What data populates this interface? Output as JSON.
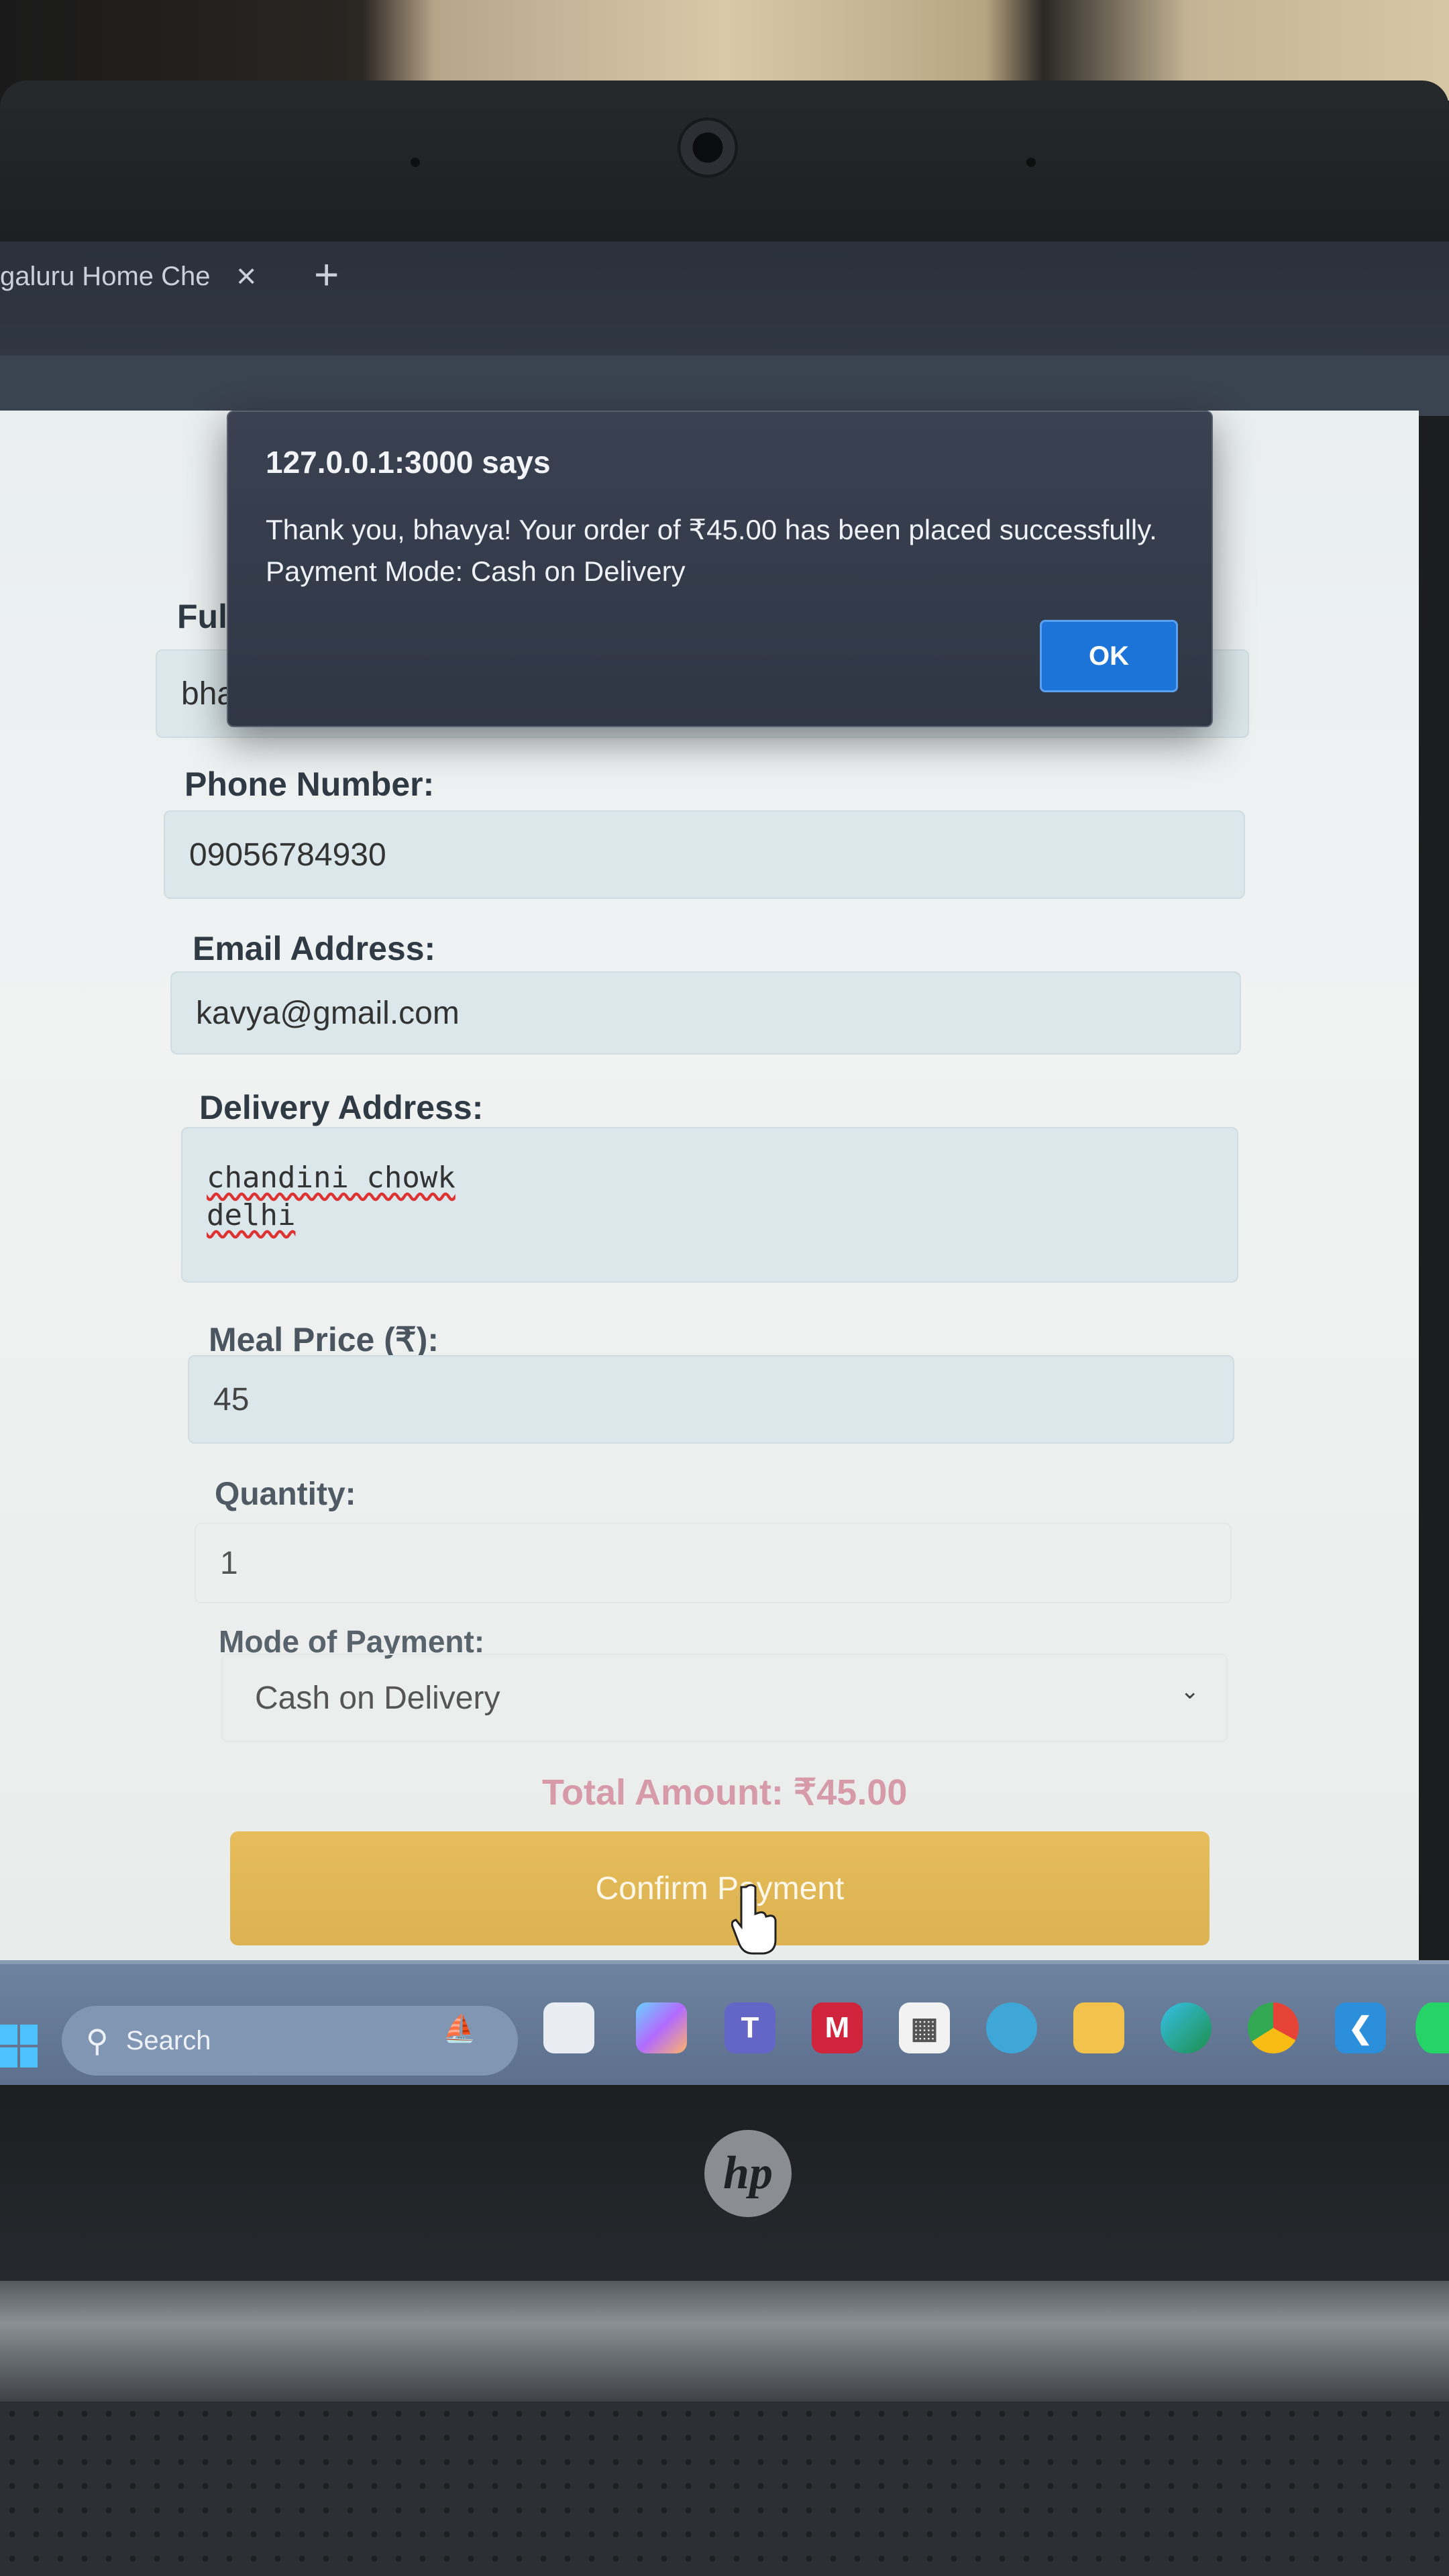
{
  "browser": {
    "tab_title": "galuru Home Che",
    "tab_close": "×",
    "new_tab": "+"
  },
  "form": {
    "full_name_label": "Ful",
    "full_name_value": "bha",
    "phone_label": "Phone Number:",
    "phone_value": "09056784930",
    "email_label": "Email Address:",
    "email_value": "kavya@gmail.com",
    "address_label": "Delivery Address:",
    "address_line1": "chandini chowk",
    "address_line2": "delhi",
    "price_label": "Meal Price (₹):",
    "price_value": "45",
    "quantity_label": "Quantity:",
    "quantity_value": "1",
    "payment_label": "Mode of Payment:",
    "payment_value": "Cash on Delivery",
    "total": "Total Amount: ₹45.00",
    "confirm_label": "Confirm Payment"
  },
  "dialog": {
    "title": "127.0.0.1:3000 says",
    "message_line1": "Thank you, bhavya! Your order of ₹45.00 has been placed successfully.",
    "message_line2": "Payment Mode: Cash on Delivery",
    "ok_label": "OK"
  },
  "taskbar": {
    "search_label": "Search",
    "icons": [
      "start-icon",
      "widgets-icon",
      "task-view-icon",
      "copilot-icon",
      "teams-icon",
      "mcafee-icon",
      "store-icon",
      "chat-icon",
      "file-explorer-icon",
      "edge-icon",
      "chrome-icon",
      "vscode-icon",
      "whatsapp-icon"
    ]
  },
  "device": {
    "brand": "hp"
  },
  "colors": {
    "ok_button": "#1d74d8",
    "confirm_button": "#e3b958",
    "total_text": "#d69aa8",
    "taskbar": "#6479 96",
    "dialog_bg": "#343b4a"
  }
}
